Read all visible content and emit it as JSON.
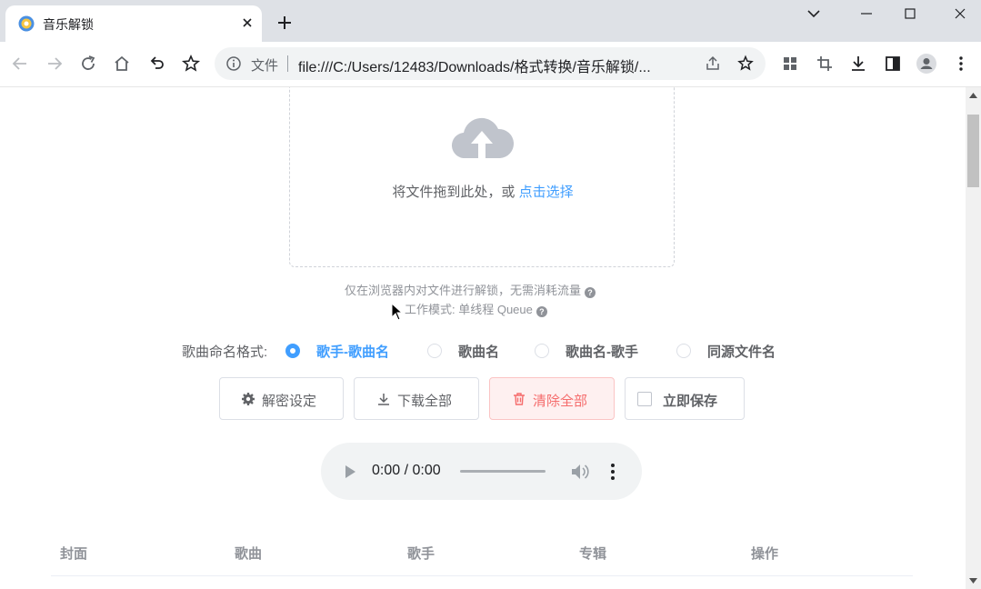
{
  "browser": {
    "tab_title": "音乐解锁",
    "omnibox": {
      "security_label": "文件",
      "url": "file:///C:/Users/12483/Downloads/格式转换/音乐解锁/..."
    }
  },
  "upload": {
    "prompt": "将文件拖到此处，或 ",
    "link": "点击选择"
  },
  "hints": {
    "local_only": "仅在浏览器内对文件进行解锁，无需消耗流量",
    "work_mode": "工作模式: 单线程 Queue"
  },
  "naming": {
    "label": "歌曲命名格式:",
    "options": [
      "歌手-歌曲名",
      "歌曲名",
      "歌曲名-歌手",
      "同源文件名"
    ],
    "selected": "歌手-歌曲名"
  },
  "actions": {
    "settings": "解密设定",
    "download_all": "下载全部",
    "clear_all": "清除全部",
    "save_now": "立即保存"
  },
  "player": {
    "time": "0:00 / 0:00"
  },
  "table": {
    "columns": [
      "封面",
      "歌曲",
      "歌手",
      "专辑",
      "操作"
    ]
  },
  "colors": {
    "accent": "#409eff",
    "danger": "#f56c6c",
    "muted": "#909399"
  }
}
